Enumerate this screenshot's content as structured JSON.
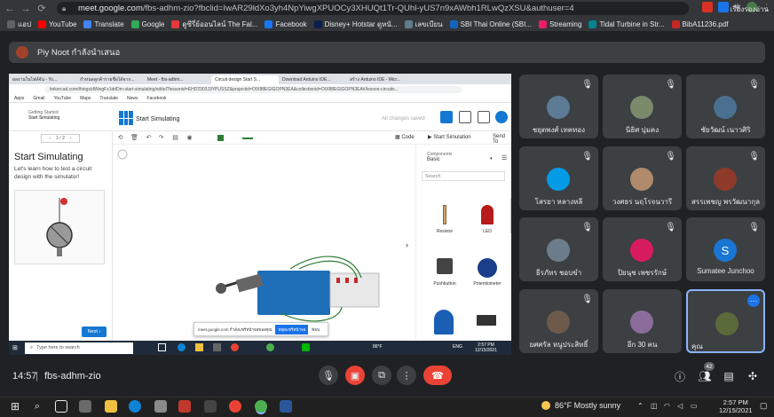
{
  "browser": {
    "url_host": "meet.google.com",
    "url_rest": "/fbs-adhm-zio?fbclid=IwAR29ldXo3yh4NpYiwgXPUOCy3XHUQt1Tr-QUhl-yUS7n9xAWbh1RLwQzXSU&authuser=4",
    "bookmarks": [
      {
        "label": "แอป",
        "color": "#5f6368"
      },
      {
        "label": "YouTube",
        "color": "#ff0000"
      },
      {
        "label": "Translate",
        "color": "#4285f4"
      },
      {
        "label": "Google",
        "color": "#34a853"
      },
      {
        "label": "ดูซีรี่ย์ออนไลน์ The Fal...",
        "color": "#e53935"
      },
      {
        "label": "Facebook",
        "color": "#1877f2"
      },
      {
        "label": "Disney+ Hotstar ดูหนั...",
        "color": "#0b1f4f"
      },
      {
        "label": "เลขเบียน",
        "color": "#607d8b"
      },
      {
        "label": "SBI Thai Online (SBI...",
        "color": "#1565c0"
      },
      {
        "label": "Streaming",
        "color": "#e91e63"
      },
      {
        "label": "Tidal Turbine in Str...",
        "color": "#00838f"
      },
      {
        "label": "BibA11236.pdf",
        "color": "#c62828"
      }
    ],
    "reading_list": "เรื่องรองอ่าน"
  },
  "presenter": {
    "label": "Piy Noot กำลังนำเสนอ"
  },
  "shared_screen": {
    "tabs": [
      "ผลงานในไฟล์จัน - Yo...",
      "กำหนดลูกค้ารายชื่อได้จาก...",
      "Meet - fbs-adhm...",
      "Circuit design Start S...",
      "Download Arduino IDE...",
      "สร้าง Arduino IDE - Micr..."
    ],
    "url": "tinkercad.com/things/dWwgFz1ddDm-start-simulating/editel?lessonid=EHD2303J3YPUSSZ&projectid=OIX88EGIGOPN3EA&collectionid=OIX88EGIGOPN3EA#/lesson-circuits...",
    "bookmarks": [
      "Apps",
      "Gmail",
      "YouTube",
      "Maps",
      "Translate",
      "News",
      "Facebook"
    ],
    "lesson_label_1": "Getting Started",
    "lesson_label_2": "Start Simulating",
    "design_title": "Start Simulating",
    "saved_status": "All changes saved",
    "step_pager": "1 / 2",
    "lesson_title": "Start Simulating",
    "lesson_desc": "Let's learn how to test a circuit design with the simulator!",
    "next_label": "Next",
    "code_label": "Code",
    "start_sim_label": "Start Simulation",
    "send_to_label": "Send To",
    "components_label": "Components",
    "components_value": "Basic",
    "search_placeholder": "Search",
    "component_names": [
      "Resistor",
      "LED",
      "Pushbutton",
      "Potentiometer"
    ],
    "toast_text": "meet.google.com กำลังแชร์หน้าจอของคุณ",
    "toast_stop": "หยุดแชร์หน้าจอ",
    "toast_hide": "ซ่อน",
    "win_search": "Type here to search",
    "win_weather": "86°F",
    "win_lang": "ENG",
    "win_time": "2:57 PM",
    "win_date": "12/15/2021"
  },
  "participants": [
    {
      "name": "ชยุตพงศ์ เทคทอง",
      "color": "#5d7b95",
      "initial": ""
    },
    {
      "name": "นิธิศ บุ่มคง",
      "color": "#7a8a6a",
      "initial": ""
    },
    {
      "name": "ชัยวัฒน์ เนาวศิริ",
      "color": "#4a6f8f",
      "initial": ""
    },
    {
      "name": "โสรยา หลางหลี",
      "color": "#039be5",
      "initial": ""
    },
    {
      "name": "วงศธร นฤโรจนวารี",
      "color": "#b08a6a",
      "initial": ""
    },
    {
      "name": "สรรเพชญ พรวัฒนากุล",
      "color": "#8e3a2a",
      "initial": ""
    },
    {
      "name": "ธีรภัทร ชอบขำ",
      "color": "#6b7d8a",
      "initial": ""
    },
    {
      "name": "ปิยนุช เพชรรักษ์",
      "color": "#d81b60",
      "initial": ""
    },
    {
      "name": "Sumatee Junchoo",
      "color": "#1976d2",
      "initial": "S"
    },
    {
      "name": "ยศศรัล หนูประสิทธิ์",
      "color": "#6d5a4a",
      "initial": ""
    },
    {
      "name": "อีก 30 คน",
      "color": "#8a6d9a",
      "initial": ""
    },
    {
      "name": "คุณ",
      "color": "#5a6a3a",
      "initial": ""
    }
  ],
  "meeting": {
    "time": "14:57",
    "code": "fbs-adhm-zio",
    "people_count": "42"
  },
  "os": {
    "weather": "86°F  Mostly sunny",
    "time": "2:57 PM",
    "date": "12/15/2021"
  }
}
